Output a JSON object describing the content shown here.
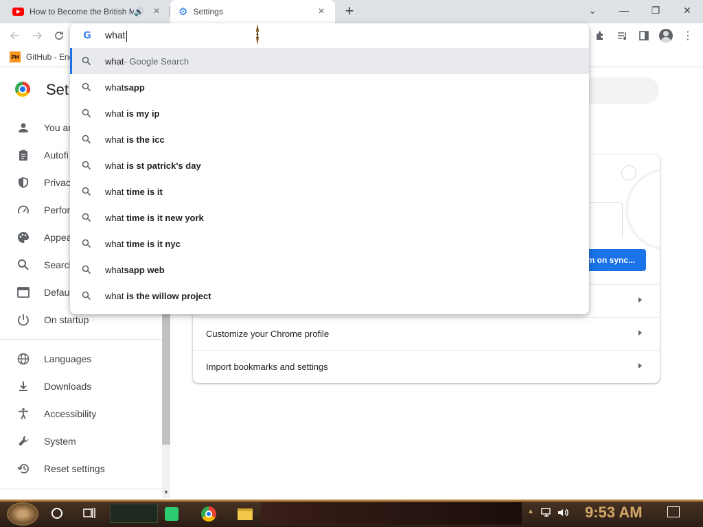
{
  "tabs": [
    {
      "title": "How to Become the British M",
      "icon": "youtube-icon",
      "active": false,
      "audio": true
    },
    {
      "title": "Settings",
      "icon": "settings-gear-icon",
      "active": true
    }
  ],
  "window_controls": {
    "tab_search": "⌄",
    "minimize": "—",
    "restore": "❐",
    "close": "✕"
  },
  "omnibox": {
    "value": "what",
    "suggestions": [
      {
        "prefix": "what",
        "bold": "",
        "suffix": " - Google Search",
        "selected": true
      },
      {
        "prefix": "what",
        "bold": "sapp",
        "suffix": ""
      },
      {
        "prefix": "what ",
        "bold": "is my ip",
        "suffix": ""
      },
      {
        "prefix": "what ",
        "bold": "is the icc",
        "suffix": ""
      },
      {
        "prefix": "what ",
        "bold": "is st patrick's day",
        "suffix": ""
      },
      {
        "prefix": "what ",
        "bold": "time is it",
        "suffix": ""
      },
      {
        "prefix": "what ",
        "bold": "time is it new york",
        "suffix": ""
      },
      {
        "prefix": "what ",
        "bold": "time is it nyc",
        "suffix": ""
      },
      {
        "prefix": "what",
        "bold": "sapp web",
        "suffix": ""
      },
      {
        "prefix": "what ",
        "bold": "is the willow project",
        "suffix": ""
      }
    ]
  },
  "bookmarks": [
    {
      "label": "GitHub - Enc",
      "icon": "PH"
    }
  ],
  "settings": {
    "title": "Set",
    "sidebar": [
      {
        "label": "You ar",
        "icon": "person-icon"
      },
      {
        "label": "Autofi",
        "icon": "clipboard-icon"
      },
      {
        "label": "Privac",
        "icon": "shield-icon"
      },
      {
        "label": "Perfor",
        "icon": "speedometer-icon"
      },
      {
        "label": "Appea",
        "icon": "palette-icon"
      },
      {
        "label": "Search",
        "icon": "search-icon"
      },
      {
        "label": "Defau",
        "icon": "browser-icon"
      },
      {
        "label": "On startup",
        "icon": "power-icon"
      },
      {
        "label": "Languages",
        "icon": "globe-icon"
      },
      {
        "label": "Downloads",
        "icon": "download-icon"
      },
      {
        "label": "Accessibility",
        "icon": "accessibility-icon"
      },
      {
        "label": "System",
        "icon": "wrench-icon"
      },
      {
        "label": "Reset settings",
        "icon": "restore-icon"
      }
    ],
    "sync_button": "rn on sync...",
    "rows": [
      "",
      "Customize your Chrome profile",
      "Import bookmarks and settings"
    ]
  },
  "taskbar": {
    "clock": "9:53 AM",
    "apps": [
      "notes-icon",
      "chrome-icon",
      "file-explorer-icon"
    ]
  },
  "colors": {
    "accent": "#1a73e8",
    "tab_strip": "#dee1e6",
    "clock": "#d4a868"
  }
}
